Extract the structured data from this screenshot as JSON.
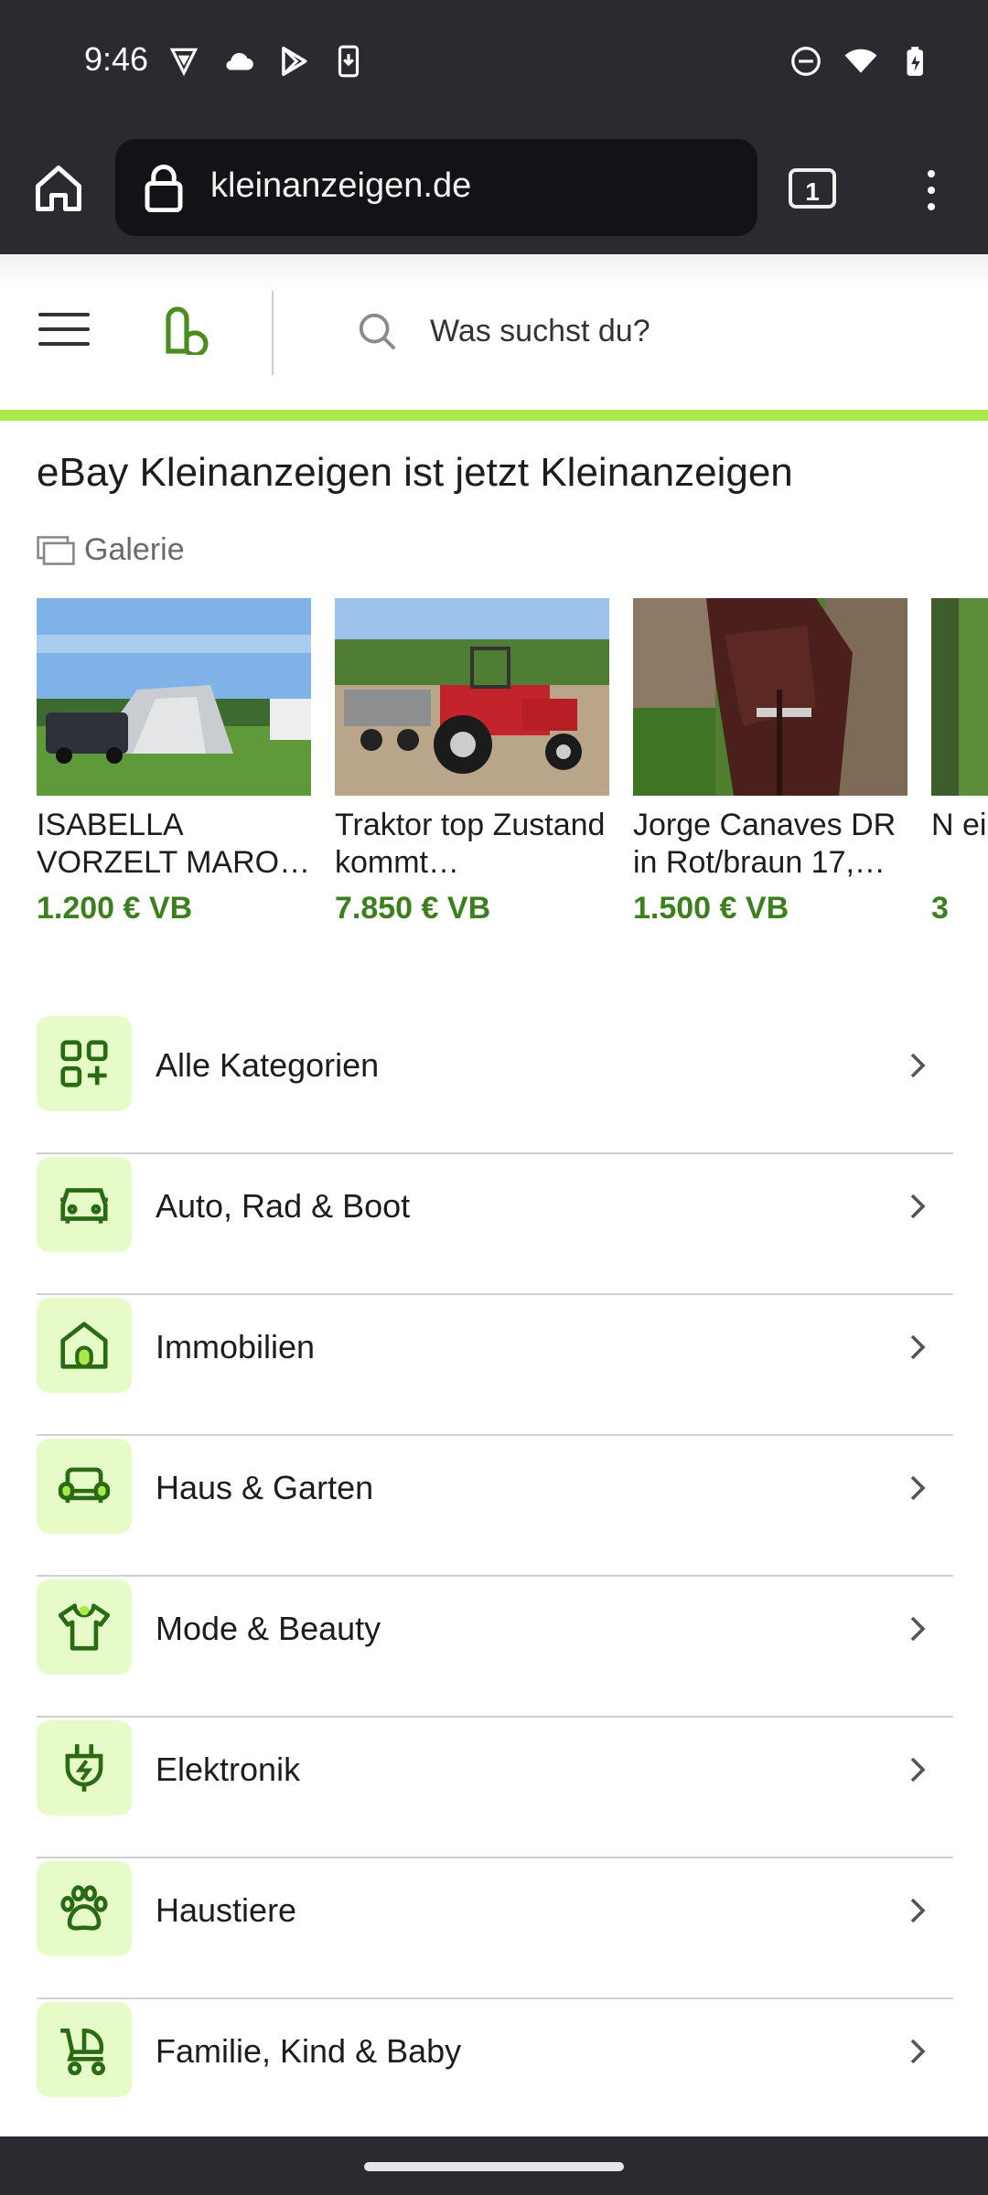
{
  "status_bar": {
    "time": "9:46",
    "left_icons": [
      "vpn-shield-icon",
      "cloud-icon",
      "play-store-icon",
      "download-icon"
    ],
    "right_icons": [
      "do-not-disturb-icon",
      "wifi-icon",
      "battery-charging-icon"
    ]
  },
  "browser": {
    "url": "kleinanzeigen.de",
    "tab_count": "1",
    "icons": [
      "home-icon",
      "lock-icon",
      "tab-switcher-icon",
      "more-vert-icon"
    ]
  },
  "site_header": {
    "search_placeholder": "Was suchst du?",
    "accent_color": "#a9ea4a"
  },
  "main": {
    "title": "eBay Kleinanzeigen ist jetzt Kleinanzeigen",
    "gallery_label": "Galerie",
    "gallery_items": [
      {
        "title": "ISABELLA VORZELT MARO…",
        "price": "1.200 € VB",
        "image": "tent-car-photo"
      },
      {
        "title": "Traktor top Zustand kommt…",
        "price": "7.850 € VB",
        "image": "red-tractor-photo"
      },
      {
        "title": "Jorge Canaves DR in Rot/braun 17,…",
        "price": "1.500 € VB",
        "image": "saddle-photo"
      },
      {
        "title": "N ei",
        "price": "3",
        "image": "partial-photo"
      }
    ],
    "price_color": "#3c7f1e"
  },
  "categories": [
    {
      "label": "Alle Kategorien",
      "icon": "grid-plus-icon"
    },
    {
      "label": "Auto, Rad & Boot",
      "icon": "car-icon"
    },
    {
      "label": "Immobilien",
      "icon": "house-icon"
    },
    {
      "label": "Haus & Garten",
      "icon": "sofa-icon"
    },
    {
      "label": "Mode & Beauty",
      "icon": "shirt-icon"
    },
    {
      "label": "Elektronik",
      "icon": "plug-icon"
    },
    {
      "label": "Haustiere",
      "icon": "paw-icon"
    },
    {
      "label": "Familie, Kind & Baby",
      "icon": "stroller-icon"
    }
  ]
}
